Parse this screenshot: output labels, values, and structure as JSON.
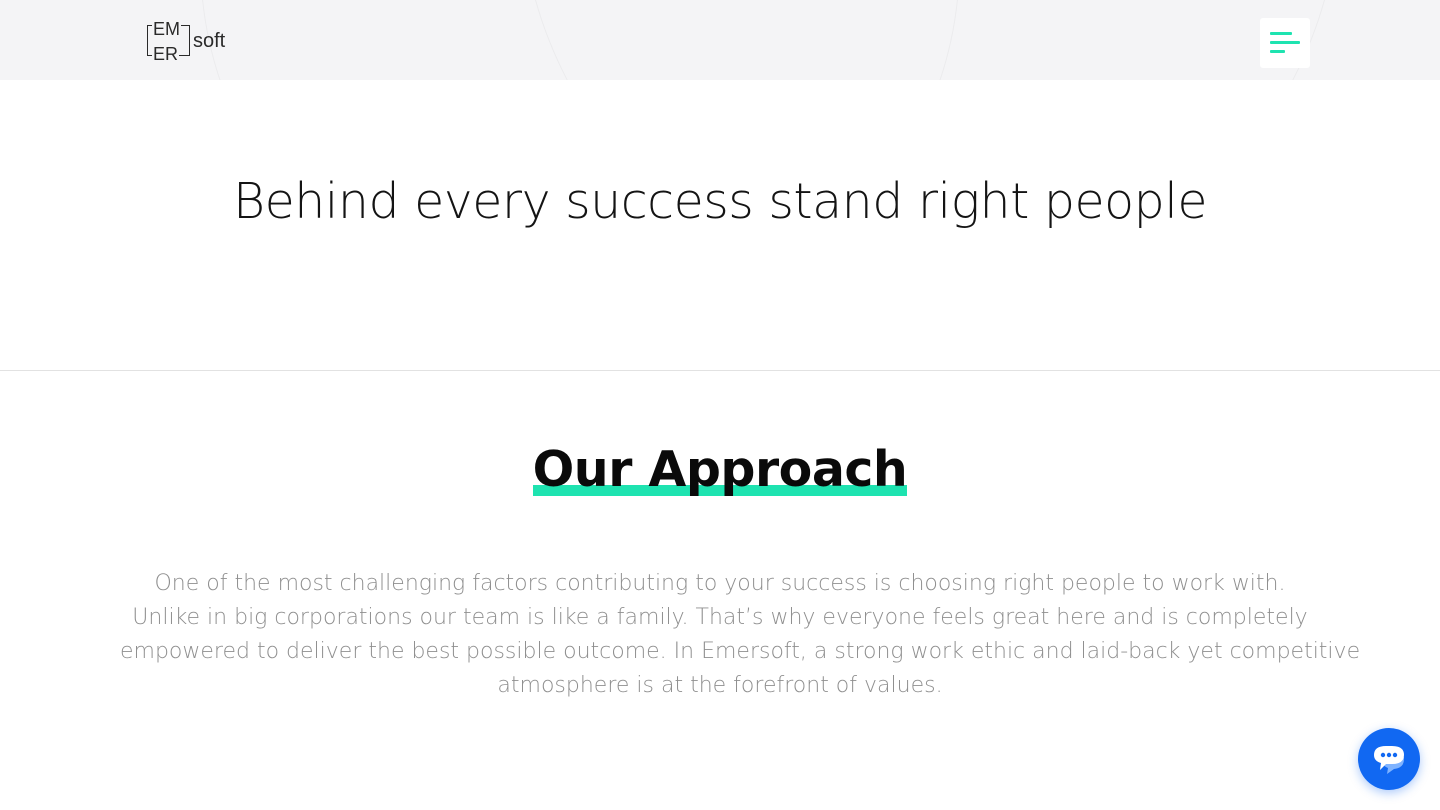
{
  "header": {
    "logo": {
      "line1": "EM",
      "line2": "ER",
      "suffix": "soft"
    },
    "menu_icon": "hamburger-menu-icon",
    "accent_color": "#1ee3b0"
  },
  "hero": {
    "title": "Behind every success stand right people"
  },
  "approach": {
    "heading": "Our Approach",
    "paragraph_lines": [
      "One of the most challenging factors contributing to your success is choosing right people to work with.",
      "Unlike in big corporations our team is like a family. That’s why everyone feels great here and is completely",
      "empowered to deliver the best possible outcome. In Emersoft, a strong work ethic and laid-back yet competitive",
      "atmosphere is at the forefront of values."
    ]
  },
  "chat": {
    "icon": "chat-bubble-icon",
    "color": "#1168f2"
  }
}
